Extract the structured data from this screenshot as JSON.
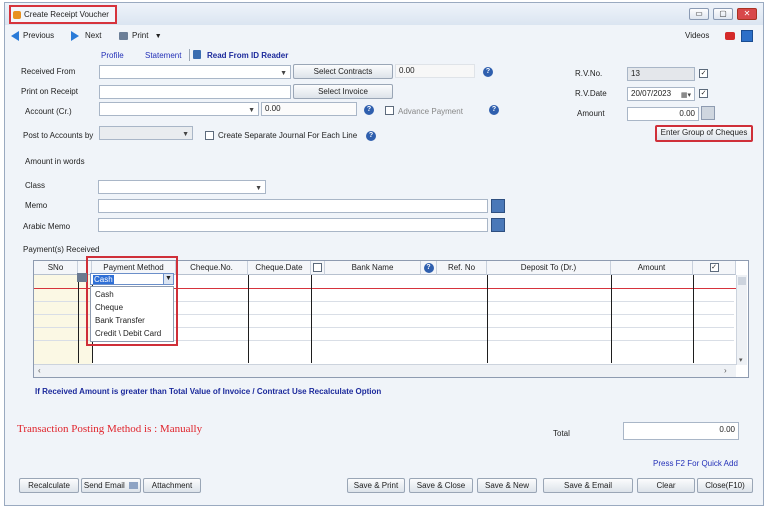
{
  "window": {
    "title": "Create Receipt Voucher",
    "controls": {
      "minimize": "▭",
      "restore": "▢",
      "close": "✕"
    }
  },
  "toolbar": {
    "previous": "Previous",
    "next": "Next",
    "print": "Print",
    "videos": "Videos"
  },
  "links": {
    "profile": "Profile",
    "statement": "Statement",
    "read_id": "Read From ID Reader"
  },
  "form": {
    "received_from_label": "Received From",
    "select_contracts": "Select Contracts",
    "contracts_value": "0.00",
    "print_on_receipt_label": "Print on Receipt",
    "select_invoice": "Select Invoice",
    "account_label": "Account (Cr.)",
    "account_amount": "0.00",
    "advance_payment": "Advance Payment",
    "post_to_label": "Post to Accounts by",
    "separate_journal": "Create Separate Journal For Each Line",
    "amount_in_words_label": "Amount in words",
    "class_label": "Class",
    "memo_label": "Memo",
    "arabic_memo_label": "Arabic Memo",
    "rv_no_label": "R.V.No.",
    "rv_no_value": "13",
    "rv_date_label": "R.V.Date",
    "rv_date_value": "20/07/2023",
    "amount_label": "Amount",
    "amount_value": "0.00",
    "enter_group_cheques": "Enter Group of Cheques"
  },
  "payments": {
    "section_label": "Payment(s) Received",
    "columns": [
      "SNo",
      "Payment Method",
      "Cheque.No.",
      "Cheque.Date",
      "Bank Name",
      "Ref. No",
      "Deposit To (Dr.)",
      "Amount"
    ],
    "current_value": "Cash",
    "options": [
      "Cash",
      "Cheque",
      "Bank Transfer",
      "Credit \\ Debit Card"
    ]
  },
  "notice": "If Received Amount is greater than Total Value of Invoice / Contract Use Recalculate Option",
  "posting_method": "Transaction Posting Method is : Manually",
  "total_label": "Total",
  "total_value": "0.00",
  "quick_add_hint": "Press F2 For Quick Add",
  "footer": {
    "recalculate": "Recalculate",
    "send_email": "Send Email",
    "attachment": "Attachment",
    "save_print": "Save & Print",
    "save_close": "Save & Close",
    "save_new": "Save & New",
    "save_email": "Save & Email",
    "clear": "Clear",
    "close": "Close(F10)"
  },
  "colors": {
    "accent_red": "#d6333c",
    "link_blue": "#2330b8",
    "notice_blue": "#1c2a9c",
    "posting_red": "#e0242c"
  }
}
